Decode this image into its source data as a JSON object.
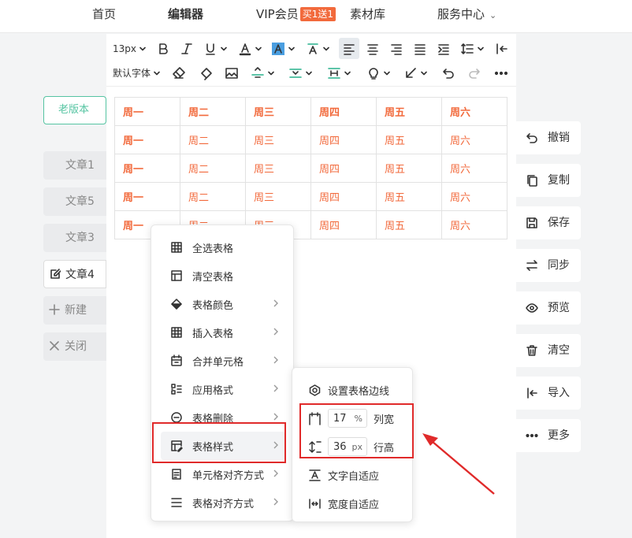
{
  "nav": {
    "items": [
      {
        "label": "首页"
      },
      {
        "label": "编辑器"
      },
      {
        "label": "VIP会员",
        "badge": "买1送1"
      },
      {
        "label": "素材库"
      },
      {
        "label": "服务中心"
      }
    ]
  },
  "toolbar": {
    "font_size": "13px",
    "font_family": "默认字体"
  },
  "table": {
    "rows": [
      [
        "周一",
        "周二",
        "周三",
        "周四",
        "周五",
        "周六"
      ],
      [
        "周一",
        "周二",
        "周三",
        "周四",
        "周五",
        "周六"
      ],
      [
        "周一",
        "周二",
        "周三",
        "周四",
        "周五",
        "周六"
      ],
      [
        "周一",
        "周二",
        "周三",
        "周四",
        "周五",
        "周六"
      ],
      [
        "周一",
        "周二",
        "周三",
        "周四",
        "周五",
        "周六"
      ]
    ]
  },
  "sidebar": {
    "old_version": "老版本",
    "items": [
      {
        "label": "文章1"
      },
      {
        "label": "文章5"
      },
      {
        "label": "文章3"
      },
      {
        "label": "文章4"
      },
      {
        "label": "新建"
      },
      {
        "label": "关闭"
      }
    ]
  },
  "actions": [
    {
      "label": "撤销",
      "icon": "undo-icon"
    },
    {
      "label": "复制",
      "icon": "copy-icon"
    },
    {
      "label": "保存",
      "icon": "save-icon"
    },
    {
      "label": "同步",
      "icon": "sync-icon"
    },
    {
      "label": "预览",
      "icon": "eye-icon"
    },
    {
      "label": "清空",
      "icon": "trash-icon"
    },
    {
      "label": "导入",
      "icon": "import-icon"
    },
    {
      "label": "更多",
      "icon": "more-icon"
    }
  ],
  "menu": {
    "items": [
      {
        "label": "全选表格"
      },
      {
        "label": "清空表格"
      },
      {
        "label": "表格颜色"
      },
      {
        "label": "插入表格"
      },
      {
        "label": "合并单元格"
      },
      {
        "label": "应用格式"
      },
      {
        "label": "表格删除"
      },
      {
        "label": "表格样式"
      },
      {
        "label": "单元格对齐方式"
      },
      {
        "label": "表格对齐方式"
      }
    ]
  },
  "submenu": {
    "border": "设置表格边线",
    "col_width_value": "17",
    "col_width_unit": "%",
    "col_width_label": "列宽",
    "row_height_value": "36",
    "row_height_unit": "px",
    "row_height_label": "行高",
    "text_fit": "文字自适应",
    "width_fit": "宽度自适应"
  },
  "colors": {
    "accent": "#f26a3c",
    "brand": "#55c4a2",
    "annotation": "#e02a2a"
  }
}
